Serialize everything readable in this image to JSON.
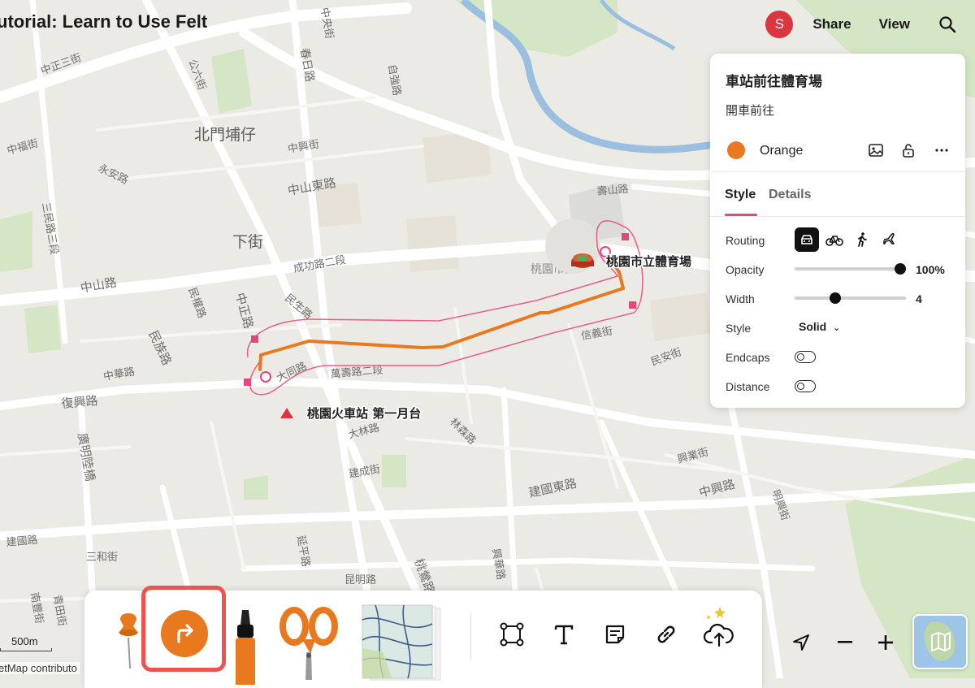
{
  "header": {
    "title": "utorial: Learn to Use Felt",
    "avatar_letter": "S",
    "share_label": "Share",
    "view_label": "View"
  },
  "map_labels": {
    "stadium": "桃園市立體育場",
    "station": "桃園火車站 第一月台",
    "stadium_faint": "桃園市立",
    "districts": [
      "北門埔仔",
      "下街"
    ],
    "streets": [
      "中正三街",
      "公六街",
      "春日路",
      "自強路",
      "中央街",
      "中福街",
      "永安路",
      "中興街",
      "中山東路",
      "三民路三段",
      "成功路二段",
      "中山路",
      "民權路",
      "中正路",
      "民生路",
      "民族路",
      "大同路",
      "萬壽路二段",
      "中華路",
      "復興路",
      "信義街",
      "壽山路",
      "民安街",
      "大林路",
      "林森路",
      "建成街",
      "建國東路",
      "中興路",
      "興業街",
      "明興街",
      "廣明陸橋",
      "建國路",
      "三和街",
      "延平路",
      "昆明路",
      "南豐街",
      "青田街",
      "桃鶯路",
      "興華路"
    ]
  },
  "panel": {
    "title": "車站前往體育場",
    "subtitle": "開車前往",
    "color_name": "Orange",
    "color_hex": "#e8791f",
    "tabs": {
      "style": "Style",
      "details": "Details",
      "active": "Style"
    },
    "routing_label": "Routing",
    "routing_modes": [
      "car-icon",
      "bike-icon",
      "walk-icon",
      "plane-icon"
    ],
    "routing_selected": "car-icon",
    "opacity_label": "Opacity",
    "opacity_value": "100%",
    "opacity_fraction": 1.0,
    "width_label": "Width",
    "width_value": "4",
    "width_fraction": 0.35,
    "style_label": "Style",
    "style_value": "Solid",
    "endcaps_label": "Endcaps",
    "endcaps_on": false,
    "distance_label": "Distance",
    "distance_on": false
  },
  "toolbar": {
    "tools": [
      "pin-tool-icon",
      "route-tool-icon",
      "marker-tool-icon",
      "scissors-tool-icon",
      "map-layers-tool-icon",
      "polygon-tool-icon",
      "text-tool-icon",
      "note-tool-icon",
      "link-tool-icon",
      "upload-tool-icon"
    ],
    "selected": "route-tool-icon"
  },
  "map_controls": {
    "scale_label": "500m",
    "attribution": "etMap contributo"
  },
  "colors": {
    "accent": "#e8457a",
    "route": "#e8791f",
    "avatar": "#d9363e",
    "highlight": "#ef5350"
  }
}
